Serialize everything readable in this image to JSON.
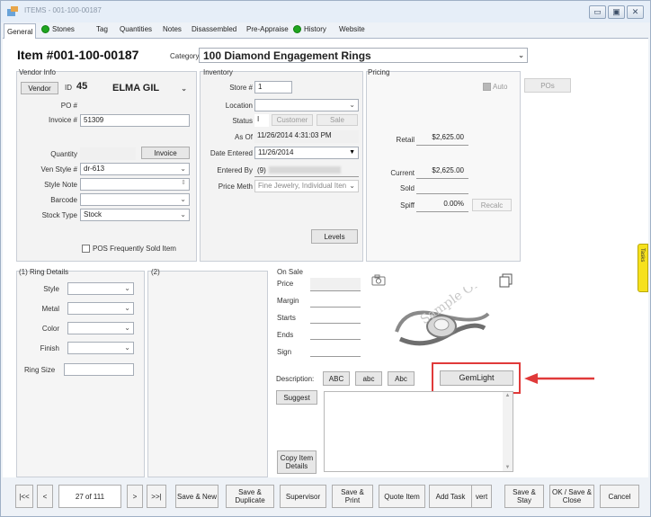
{
  "window": {
    "title": "ITEMS - 001-100-00187"
  },
  "tabs": [
    {
      "label": "General"
    },
    {
      "label": "Stones"
    },
    {
      "label": "Tag"
    },
    {
      "label": "Quantities"
    },
    {
      "label": "Notes"
    },
    {
      "label": "Disassembled"
    },
    {
      "label": "Pre-Appraise"
    },
    {
      "label": "History"
    },
    {
      "label": "Website"
    }
  ],
  "header": {
    "item_number": "Item #001-100-00187",
    "category_label": "Category",
    "category_code": "100",
    "category_name": "Diamond Engagement Rings"
  },
  "vendor": {
    "section": "Vendor Info",
    "vendor_btn": "Vendor",
    "id_label": "ID",
    "id_value": "45",
    "name": "ELMA GIL",
    "po_label": "PO #",
    "invoice_label": "Invoice #",
    "invoice_value": "51309",
    "quantity_label": "Quantity",
    "invoice_btn": "Invoice",
    "ven_style_label": "Ven Style #",
    "ven_style_value": "dr-613",
    "style_note_label": "Style Note",
    "barcode_label": "Barcode",
    "stock_type_label": "Stock Type",
    "stock_type_value": "Stock",
    "pos_label": "POS Frequently Sold Item"
  },
  "inventory": {
    "section": "Inventory",
    "store_label": "Store #",
    "store_value": "1",
    "location_label": "Location",
    "status_label": "Status",
    "status_value": "I",
    "customer_btn": "Customer",
    "sale_btn": "Sale",
    "asof_label": "As Of",
    "asof_value": "11/26/2014 4:31:03 PM",
    "date_entered_label": "Date Entered",
    "date_entered_value": "11/26/2014",
    "entered_by_label": "Entered By",
    "entered_by_value": "(9)",
    "price_meth_label": "Price Meth",
    "price_meth_value": "Fine Jewelry, Individual Iten",
    "levels_btn": "Levels"
  },
  "pricing": {
    "section": "Pricing",
    "auto_label": "Auto",
    "pos_btn": "POs",
    "retail_label": "Retail",
    "retail_value": "$2,625.00",
    "current_label": "Current",
    "current_value": "$2,625.00",
    "sold_label": "Sold",
    "spiff_label": "Spiff",
    "spiff_value": "0.00%",
    "recalc_btn": "Recalc"
  },
  "ring": {
    "section": "(1) Ring Details",
    "style_label": "Style",
    "metal_label": "Metal",
    "color_label": "Color",
    "finish_label": "Finish",
    "size_label": "Ring Size",
    "section2": "(2)"
  },
  "onsale": {
    "section": "On Sale",
    "price_label": "Price",
    "margin_label": "Margin",
    "starts_label": "Starts",
    "ends_label": "Ends",
    "sign_label": "Sign"
  },
  "image": {
    "watermark": "Sample Only"
  },
  "description": {
    "label": "Description:",
    "btn_upper": "ABC",
    "btn_lower": "abc",
    "btn_title": "Abc",
    "gemlight_btn": "GemLight",
    "suggest_btn": "Suggest",
    "copy_btn": "Copy Item Details"
  },
  "side_tab": {
    "label": "Tasks"
  },
  "nav": {
    "first": "|<<",
    "prev": "<",
    "counter": "27 of 111",
    "next": ">",
    "last": ">>|",
    "save_new": "Save & New",
    "save_dup": "Save & Duplicate",
    "supervisor": "Supervisor",
    "save_print": "Save & Print",
    "quote": "Quote Item",
    "add_task": "Add Task",
    "vert": "vert",
    "save_stay": "Save & Stay",
    "ok_close": "OK / Save & Close",
    "cancel": "Cancel"
  },
  "colors": {
    "annotation": "#e03a3a",
    "status_green": "#1fa51f",
    "side_tab": "#f6e11c"
  }
}
